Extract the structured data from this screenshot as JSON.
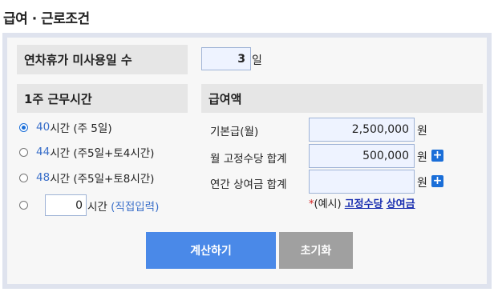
{
  "page": {
    "title": "급여 · 근로조건"
  },
  "leave": {
    "label": "연차휴가 미사용일 수",
    "value": "3",
    "unit": "일"
  },
  "work": {
    "header": "1주 근무시간",
    "options": [
      {
        "hours": "40",
        "hours_unit": "시간",
        "desc": "(주 5일)",
        "checked": true
      },
      {
        "hours": "44",
        "hours_unit": "시간",
        "desc": "(주5일+토4시간)",
        "checked": false
      },
      {
        "hours": "48",
        "hours_unit": "시간",
        "desc": "(주5일+토8시간)",
        "checked": false
      }
    ],
    "custom": {
      "value": "0",
      "unit": "시간",
      "link": "(직접입력)"
    }
  },
  "pay": {
    "header": "급여액",
    "rows": [
      {
        "label": "기본급(월)",
        "value": "2,500,000",
        "unit": "원"
      },
      {
        "label": "월 고정수당 합계",
        "value": "500,000",
        "unit": "원",
        "icon": "plus-icon"
      },
      {
        "label": "연간 상여금 합계",
        "value": "",
        "unit": "원",
        "icon": "plus-icon"
      }
    ],
    "note_prefix": "(예시)",
    "note_links": [
      "고정수당",
      "상여금"
    ]
  },
  "buttons": {
    "calculate": {
      "label": "계산하기",
      "color": "#4a89e8"
    },
    "reset": {
      "label": "초기화",
      "color": "#a0a0a0"
    }
  }
}
